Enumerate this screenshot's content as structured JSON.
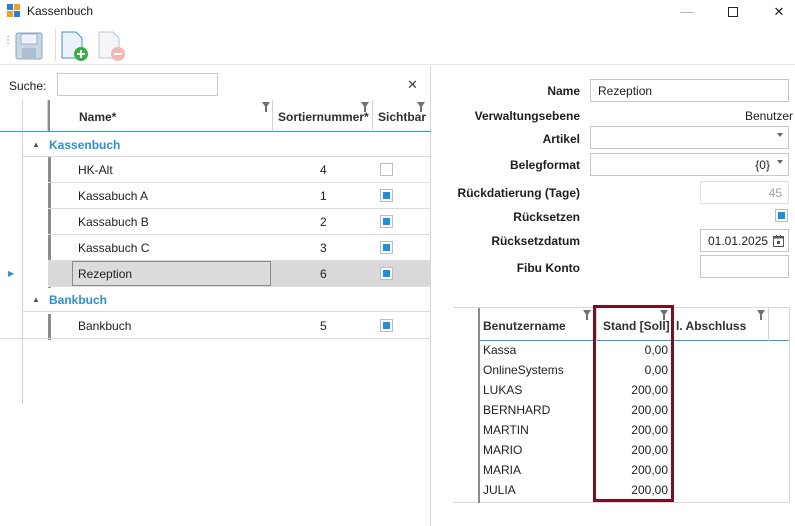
{
  "window": {
    "title": "Kassenbuch",
    "minimize": "—",
    "maximize": "☐",
    "close": "✕"
  },
  "toolbar": {
    "save_icon": "save-disk-icon",
    "new_icon": "new-document-add-icon",
    "delete_icon": "document-remove-icon"
  },
  "search": {
    "label": "Suche:",
    "value": "",
    "placeholder": "",
    "clear": "✕"
  },
  "tree_grid": {
    "columns": [
      "Name*",
      "Sortiernummer*",
      "Sichtbar"
    ],
    "groups": [
      {
        "label": "Kassenbuch",
        "rows": [
          {
            "name": "HK-Alt",
            "sort": "4",
            "visible": false
          },
          {
            "name": "Kassabuch A",
            "sort": "1",
            "visible": true
          },
          {
            "name": "Kassabuch B",
            "sort": "2",
            "visible": true
          },
          {
            "name": "Kassabuch C",
            "sort": "3",
            "visible": true
          },
          {
            "name": "Rezeption",
            "sort": "6",
            "visible": true,
            "selected": true
          }
        ]
      },
      {
        "label": "Bankbuch",
        "rows": [
          {
            "name": "Bankbuch",
            "sort": "5",
            "visible": true
          }
        ]
      }
    ]
  },
  "detail": {
    "name_label": "Name",
    "name_value": "Rezeption",
    "verwaltung_label": "Verwaltungsebene",
    "verwaltung_value": "Benutzer",
    "artikel_label": "Artikel",
    "artikel_value": "",
    "belegformat_label": "Belegformat",
    "belegformat_value": "{0}",
    "rueckdatierung_label": "Rückdatierung (Tage)",
    "rueckdatierung_value": "45",
    "ruecksetzen_label": "Rücksetzen",
    "ruecksetzen_checked": true,
    "ruecksetzdatum_label": "Rücksetzdatum",
    "ruecksetzdatum_value": "01.01.2025",
    "fibu_label": "Fibu Konto",
    "fibu_value": ""
  },
  "user_grid": {
    "columns": [
      "Benutzername",
      "Stand [Soll]",
      "l. Abschluss"
    ],
    "rows": [
      {
        "user": "Kassa",
        "stand": "0,00"
      },
      {
        "user": "OnlineSystems",
        "stand": "0,00"
      },
      {
        "user": "LUKAS",
        "stand": "200,00"
      },
      {
        "user": "BERNHARD",
        "stand": "200,00"
      },
      {
        "user": "MARTIN",
        "stand": "200,00"
      },
      {
        "user": "MARIO",
        "stand": "200,00"
      },
      {
        "user": "MARIA",
        "stand": "200,00"
      },
      {
        "user": "JULIA",
        "stand": "200,00"
      }
    ]
  },
  "colors": {
    "accent": "#2f8fcb",
    "checkbox": "#1f8fd6",
    "highlight": "#7b1020",
    "selected_row": "#d9d9d9"
  }
}
